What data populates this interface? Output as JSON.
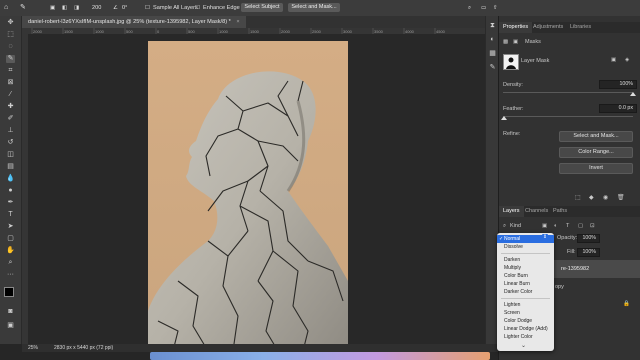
{
  "options_bar": {
    "brush_size": "200",
    "angle": "0°",
    "sample_all_layers": "Sample All Layers",
    "enhance_edge": "Enhance Edge",
    "select_subject": "Select Subject",
    "select_and_mask": "Select and Mask..."
  },
  "document": {
    "tab_title": "daniel-robert-l3z6YXsIfIM-unsplash.jpg @ 25% (texture-1395982, Layer Mask/8) *"
  },
  "ruler": {
    "labels": [
      "2000",
      "1500",
      "1000",
      "500",
      "0",
      "500",
      "1000",
      "1500",
      "2000",
      "2500",
      "3000",
      "3500",
      "4000",
      "4500"
    ]
  },
  "status": {
    "zoom": "25%",
    "doc_size": "2830 px x 5440 px (72 ppi)"
  },
  "properties": {
    "tabs": [
      "Properties",
      "Adjustments",
      "Libraries"
    ],
    "masks_label": "Masks",
    "layer_mask_label": "Layer Mask",
    "density_label": "Density:",
    "density_value": "100%",
    "feather_label": "Feather:",
    "feather_value": "0.0 px",
    "refine_label": "Refine:",
    "select_and_mask": "Select and Mask...",
    "color_range": "Color Range...",
    "invert": "Invert"
  },
  "layers": {
    "tabs": [
      "Layers",
      "Channels",
      "Paths"
    ],
    "kind": "Kind",
    "opacity_label": "Opacity:",
    "opacity_value": "100%",
    "fill_label": "Fill:",
    "fill_value": "100%",
    "layer_name": "re-1395982",
    "copy_label": "opy"
  },
  "blend_menu": {
    "selected": "Normal",
    "groups": [
      [
        "Normal",
        "Dissolve"
      ],
      [
        "Darken",
        "Multiply",
        "Color Burn",
        "Linear Burn",
        "Darker Color"
      ],
      [
        "Lighten",
        "Screen",
        "Color Dodge",
        "Linear Dodge (Add)",
        "Lighter Color"
      ]
    ]
  },
  "colors": {
    "accent": "#2a6de0",
    "panel": "#323232",
    "canvas_bg": "#282828"
  }
}
